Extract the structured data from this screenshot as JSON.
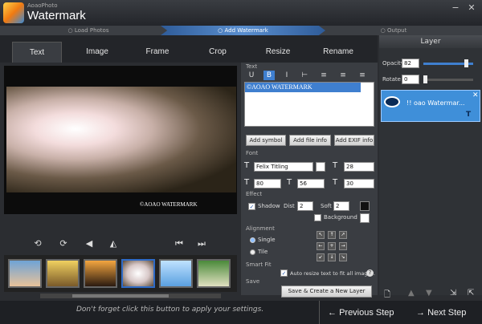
{
  "app": {
    "subtitle": "AoaoPhoto",
    "title": "Watermark"
  },
  "window": {
    "minimize": "−",
    "close": "✕"
  },
  "steps": [
    "Load Photos",
    "Add Watermark",
    "Output"
  ],
  "tabs": [
    "Text",
    "Image",
    "Frame",
    "Crop",
    "Resize",
    "Rename"
  ],
  "preview": {
    "watermark": "©AOAO WATERMARK"
  },
  "controls": {
    "rotate_left": "⟲",
    "rotate_right": "⟳",
    "flip_h": "◀",
    "flip_v": "◭",
    "prev": "⏮",
    "next": "⏭"
  },
  "text_section": {
    "title": "Text",
    "format": [
      "U",
      "B",
      "I",
      "⊢",
      "≡",
      "≡",
      "≡"
    ],
    "value": "©AOAO WATERMARK",
    "buttons": {
      "add_symbol": "Add symbol",
      "add_file_info": "Add file info",
      "add_exif": "Add EXIF info"
    }
  },
  "font_section": {
    "title": "Font",
    "family": "Felix Titling",
    "size": "28",
    "v1": "80",
    "v2": "56",
    "v3": "30"
  },
  "effect_section": {
    "title": "Effect",
    "shadow_label": "Shadow",
    "shadow_checked": true,
    "dist_label": "Dist",
    "dist": "2",
    "soft_label": "Soft",
    "soft": "2",
    "background_label": "Background",
    "background_checked": false
  },
  "alignment_section": {
    "title": "Alignment",
    "single": "Single",
    "tile": "Tile",
    "selected": "Single"
  },
  "smartfit_section": {
    "title": "Smart Fit",
    "label": "Auto resize text to fit all images.",
    "checked": true
  },
  "save_section": {
    "title": "Save",
    "button": "Save & Create a New Layer"
  },
  "layer_panel": {
    "title": "Layer",
    "opacity_label": "Opacity",
    "opacity": "82",
    "rotate_label": "Rotate",
    "rotate": "0",
    "item": "!! oao Watermar...",
    "item_type": "T",
    "item_close": "✕"
  },
  "footer": {
    "hint": "Don't forget click this button to apply your settings.",
    "prev": "Previous Step",
    "next": "Next Step"
  },
  "colors": {
    "accent": "#3f7fcf",
    "bg": "#2b2d31"
  }
}
